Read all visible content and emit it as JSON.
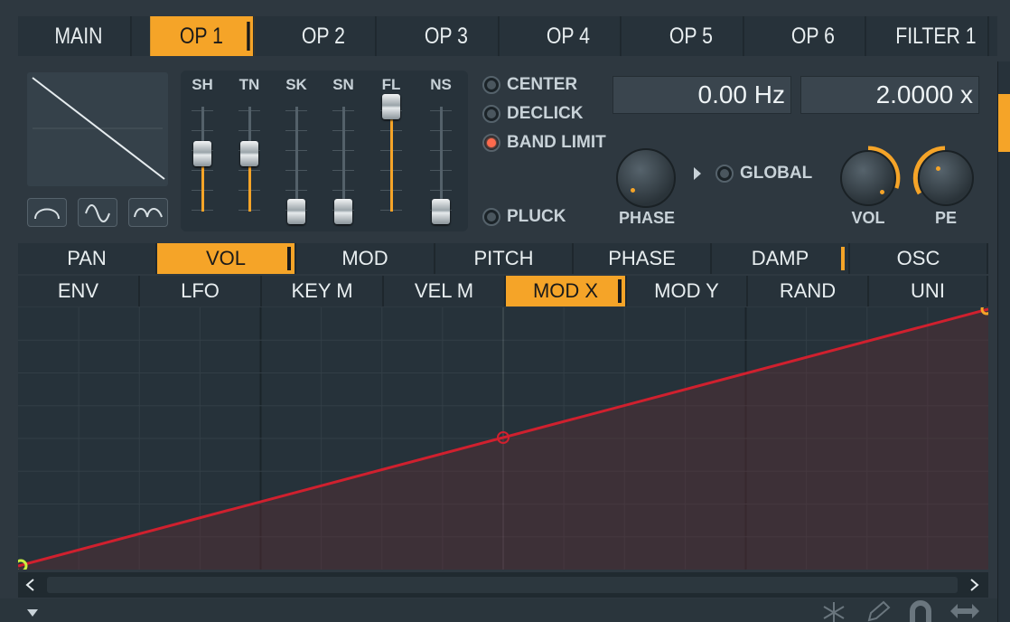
{
  "top_tabs": [
    {
      "label": "MAIN",
      "active": false
    },
    {
      "label": "OP 1",
      "active": true
    },
    {
      "label": "OP 2",
      "active": false
    },
    {
      "label": "OP 3",
      "active": false
    },
    {
      "label": "OP 4",
      "active": false
    },
    {
      "label": "OP 5",
      "active": false
    },
    {
      "label": "OP 6",
      "active": false
    },
    {
      "label": "FILTER 1",
      "active": false
    }
  ],
  "sliders": [
    {
      "label": "SH",
      "level": 0.55
    },
    {
      "label": "TN",
      "level": 0.55
    },
    {
      "label": "SK",
      "level": 0.0
    },
    {
      "label": "SN",
      "level": 0.0
    },
    {
      "label": "FL",
      "level": 1.0
    },
    {
      "label": "NS",
      "level": 0.0
    }
  ],
  "options": {
    "center": {
      "label": "CENTER",
      "on": false
    },
    "declick": {
      "label": "DECLICK",
      "on": false
    },
    "band_limit": {
      "label": "BAND LIMIT",
      "on": true
    },
    "pluck": {
      "label": "PLUCK",
      "on": false
    },
    "global": {
      "label": "GLOBAL",
      "on": false
    }
  },
  "frequency": "0.00 Hz",
  "ratio": "2.0000 x",
  "knobs": {
    "phase": "PHASE",
    "vol": "VOL",
    "pe": "PE"
  },
  "target_tabs": [
    {
      "label": "PAN",
      "active": false
    },
    {
      "label": "VOL",
      "active": true
    },
    {
      "label": "MOD",
      "active": false
    },
    {
      "label": "PITCH",
      "active": false
    },
    {
      "label": "PHASE",
      "active": false
    },
    {
      "label": "DAMP",
      "active": false,
      "marked": true
    },
    {
      "label": "OSC",
      "active": false
    }
  ],
  "source_tabs": [
    {
      "label": "ENV",
      "active": false
    },
    {
      "label": "LFO",
      "active": false
    },
    {
      "label": "KEY M",
      "active": false
    },
    {
      "label": "VEL M",
      "active": false
    },
    {
      "label": "MOD X",
      "active": true
    },
    {
      "label": "MOD Y",
      "active": false
    },
    {
      "label": "RAND",
      "active": false
    },
    {
      "label": "UNI",
      "active": false
    }
  ],
  "colors": {
    "accent": "#f5a428",
    "curve": "#d0202e",
    "background": "#2e3840"
  },
  "icons": [
    "snowflake-icon",
    "pencil-icon",
    "magnet-icon",
    "arrows-icon"
  ]
}
